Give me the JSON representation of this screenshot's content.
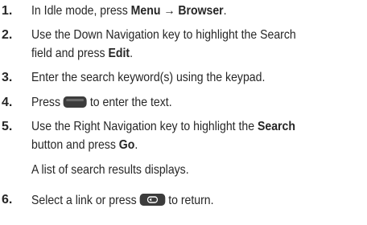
{
  "steps": [
    {
      "number": "1.",
      "text_before": "In Idle mode, press ",
      "bold_1": "Menu → Browser",
      "text_after": "."
    },
    {
      "number": "2.",
      "line1": "Use the Down Navigation key to highlight the Search",
      "line2_before": "field and press ",
      "bold_1": "Edit",
      "line2_after": "."
    },
    {
      "number": "3.",
      "text": "Enter the search keyword(s) using the keypad."
    },
    {
      "number": "4.",
      "text_before": "Press ",
      "icon": "menu-key-icon",
      "text_after": " to enter the text."
    },
    {
      "number": "5.",
      "line1_before": "Use the Right Navigation key to highlight the ",
      "bold_1": "Search",
      "line2_before": "button and press ",
      "bold_2": "Go",
      "line2_after": ".",
      "note": "A list of search results displays."
    },
    {
      "number": "6.",
      "text_before": "Select a link or press ",
      "icon": "back-key-icon",
      "text_after": " to return."
    }
  ]
}
